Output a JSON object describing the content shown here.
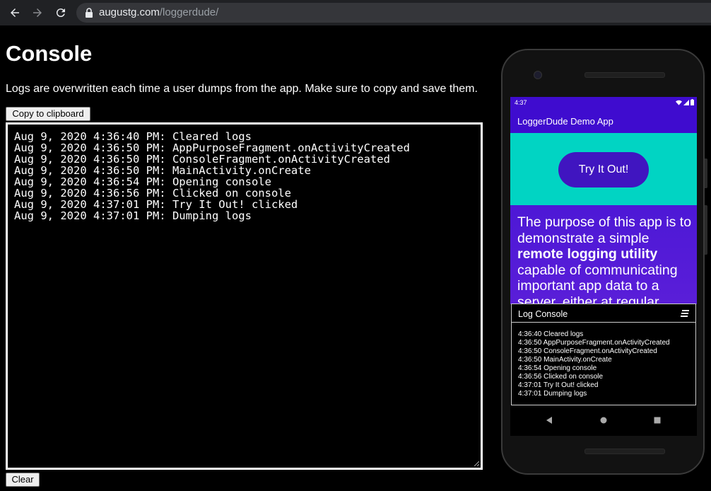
{
  "browser": {
    "url_host": "augustg.com",
    "url_path": "/loggerdude/"
  },
  "page": {
    "title": "Console",
    "info": "Logs are overwritten each time a user dumps from the app. Make sure to copy and save them.",
    "copy_label": "Copy to clipboard",
    "clear_label": "Clear",
    "logs": [
      "Aug 9, 2020 4:36:40 PM: Cleared logs",
      "Aug 9, 2020 4:36:50 PM: AppPurposeFragment.onActivityCreated",
      "Aug 9, 2020 4:36:50 PM: ConsoleFragment.onActivityCreated",
      "Aug 9, 2020 4:36:50 PM: MainActivity.onCreate",
      "Aug 9, 2020 4:36:54 PM: Opening console",
      "Aug 9, 2020 4:36:56 PM: Clicked on console",
      "Aug 9, 2020 4:37:01 PM: Try It Out! clicked",
      "Aug 9, 2020 4:37:01 PM: Dumping logs"
    ]
  },
  "phone": {
    "status_time": "4:37",
    "app_title": "LoggerDude Demo App",
    "try_button": "Try It Out!",
    "purpose_pre": "The purpose of this app is to demonstrate a simple",
    "purpose_bold": "remote logging utility",
    "purpose_post": "capable of communicating important app data to a server, either at regular",
    "log_console_title": "Log Console",
    "log_lines": [
      "4:36:40 Cleared logs",
      "4:36:50 AppPurposeFragment.onActivityCreated",
      "4:36:50 ConsoleFragment.onActivityCreated",
      "4:36:50 MainActivity.onCreate",
      "4:36:54 Opening console",
      "4:36:56 Clicked on console",
      "4:37:01 Try It Out! clicked",
      "4:37:01 Dumping logs"
    ]
  },
  "colors": {
    "app_primary": "#3f0ccf",
    "teal": "#01d4c3",
    "button": "#4015c0"
  },
  "icons": [
    "back-icon",
    "forward-icon",
    "reload-icon",
    "lock-icon",
    "wifi-icon",
    "signal-icon",
    "battery-icon",
    "menu-icon",
    "nav-back-icon",
    "nav-home-icon",
    "nav-recents-icon"
  ]
}
